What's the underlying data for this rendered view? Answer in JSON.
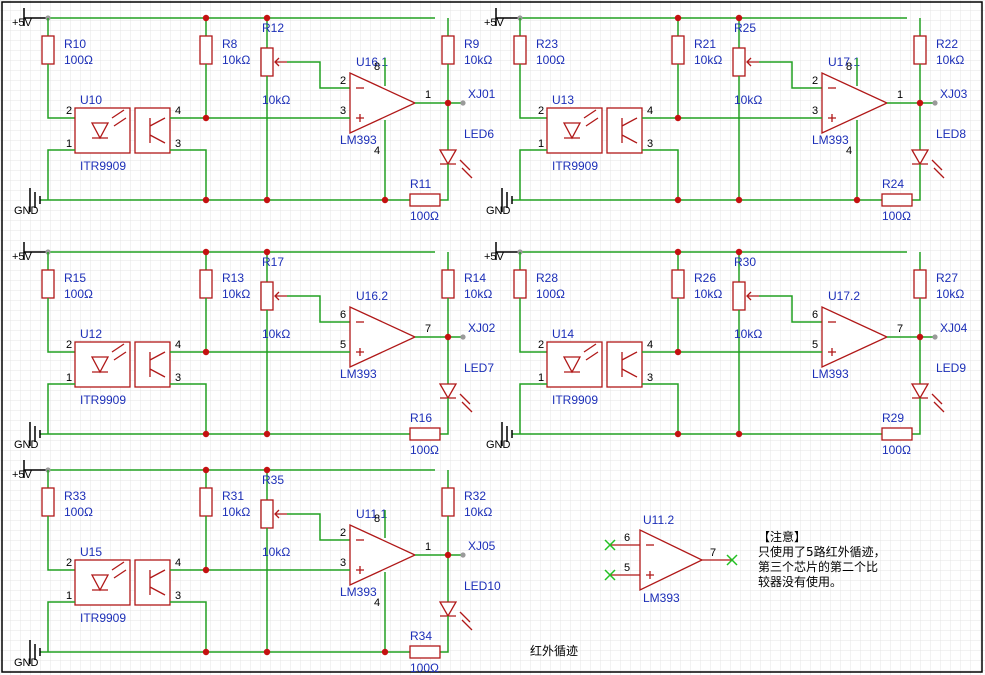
{
  "sheet_title": "红外循迹",
  "supply_label": "+5V",
  "ground_label": "GND",
  "channels": [
    {
      "r_in": "R10",
      "r_in_val": "100Ω",
      "opto": "U10",
      "opto_type": "ITR9909",
      "r_pull": "R8",
      "r_pull_val": "10kΩ",
      "pot": "R12",
      "pot_val": "10kΩ",
      "amp": "U16.1",
      "amp_type": "LM393",
      "pin_minus": "2",
      "pin_plus": "3",
      "pin_out": "1",
      "vcc_pin": "8",
      "gnd_pin": "4",
      "r_out": "R9",
      "r_out_val": "10kΩ",
      "net": "XJ01",
      "led": "LED6",
      "r_led": "R11",
      "r_led_val": "100Ω",
      "opto_pins": [
        "2",
        "1",
        "4",
        "3"
      ]
    },
    {
      "r_in": "R23",
      "r_in_val": "100Ω",
      "opto": "U13",
      "opto_type": "ITR9909",
      "r_pull": "R21",
      "r_pull_val": "10kΩ",
      "pot": "R25",
      "pot_val": "10kΩ",
      "amp": "U17.1",
      "amp_type": "LM393",
      "pin_minus": "2",
      "pin_plus": "3",
      "pin_out": "1",
      "vcc_pin": "8",
      "gnd_pin": "4",
      "r_out": "R22",
      "r_out_val": "10kΩ",
      "net": "XJ03",
      "led": "LED8",
      "r_led": "R24",
      "r_led_val": "100Ω",
      "opto_pins": [
        "2",
        "1",
        "4",
        "3"
      ]
    },
    {
      "r_in": "R15",
      "r_in_val": "100Ω",
      "opto": "U12",
      "opto_type": "ITR9909",
      "r_pull": "R13",
      "r_pull_val": "10kΩ",
      "pot": "R17",
      "pot_val": "10kΩ",
      "amp": "U16.2",
      "amp_type": "LM393",
      "pin_minus": "6",
      "pin_plus": "5",
      "pin_out": "7",
      "vcc_pin": "",
      "gnd_pin": "",
      "r_out": "R14",
      "r_out_val": "10kΩ",
      "net": "XJ02",
      "led": "LED7",
      "r_led": "R16",
      "r_led_val": "100Ω",
      "opto_pins": [
        "2",
        "1",
        "4",
        "3"
      ]
    },
    {
      "r_in": "R28",
      "r_in_val": "100Ω",
      "opto": "U14",
      "opto_type": "ITR9909",
      "r_pull": "R26",
      "r_pull_val": "10kΩ",
      "pot": "R30",
      "pot_val": "10kΩ",
      "amp": "U17.2",
      "amp_type": "LM393",
      "pin_minus": "6",
      "pin_plus": "5",
      "pin_out": "7",
      "vcc_pin": "",
      "gnd_pin": "",
      "r_out": "R27",
      "r_out_val": "10kΩ",
      "net": "XJ04",
      "led": "LED9",
      "r_led": "R29",
      "r_led_val": "100Ω",
      "opto_pins": [
        "2",
        "1",
        "4",
        "3"
      ]
    },
    {
      "r_in": "R33",
      "r_in_val": "100Ω",
      "opto": "U15",
      "opto_type": "ITR9909",
      "r_pull": "R31",
      "r_pull_val": "10kΩ",
      "pot": "R35",
      "pot_val": "10kΩ",
      "amp": "U11.1",
      "amp_type": "LM393",
      "pin_minus": "2",
      "pin_plus": "3",
      "pin_out": "1",
      "vcc_pin": "8",
      "gnd_pin": "4",
      "r_out": "R32",
      "r_out_val": "10kΩ",
      "net": "XJ05",
      "led": "LED10",
      "r_led": "R34",
      "r_led_val": "100Ω",
      "opto_pins": [
        "2",
        "1",
        "4",
        "3"
      ]
    }
  ],
  "unused_comparator": {
    "ref": "U11.2",
    "type": "LM393",
    "pin_minus": "6",
    "pin_plus": "5",
    "pin_out": "7"
  },
  "note": {
    "title": "【注意】",
    "lines": [
      "只使用了5路红外循迹，",
      "第三个芯片的第二个比",
      "较器没有使用。"
    ]
  },
  "colors": {
    "wire": "#22a022",
    "part": "#b01818",
    "label": "#1c2fb8",
    "grid": "#e4e4e4",
    "frame": "#000000"
  }
}
